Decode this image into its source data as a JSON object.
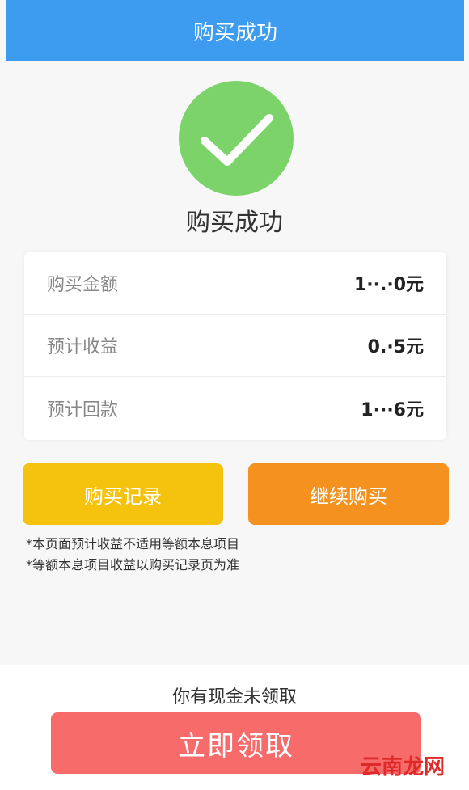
{
  "header": {
    "title": "购买成功"
  },
  "success": {
    "icon": "check-icon",
    "title": "购买成功"
  },
  "info": {
    "rows": [
      {
        "label": "购买金额",
        "value": "1··.·0元"
      },
      {
        "label": "预计收益",
        "value": "0.·5元"
      },
      {
        "label": "预计回款",
        "value": "1···6元"
      }
    ]
  },
  "buttons": {
    "records": "购买记录",
    "continue": "继续购买"
  },
  "notes": [
    "*本页面预计收益不适用等额本息项目",
    "*等额本息项目收益以购买记录页为准"
  ],
  "footer": {
    "cash_text": "你有现金未领取",
    "claim_label": "立即领取"
  },
  "watermark": {
    "text": "云南龙网"
  },
  "colors": {
    "header": "#3d9cf0",
    "success": "#7cd36a",
    "records_button": "#f5c20e",
    "continue_button": "#f5921f",
    "claim_button": "#f86b6b"
  }
}
